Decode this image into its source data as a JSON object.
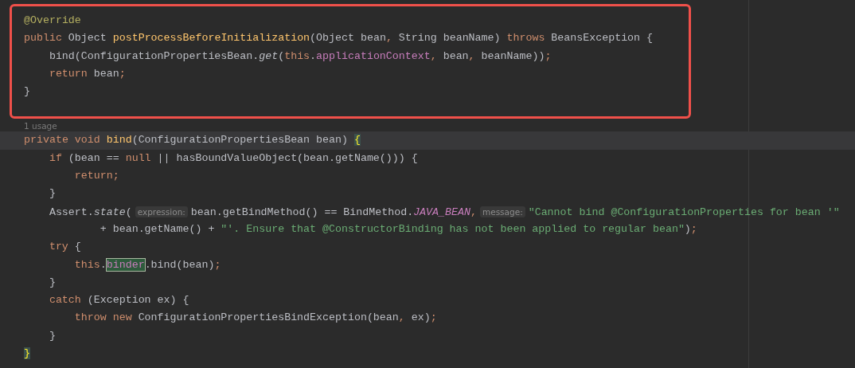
{
  "highlighted_block": {
    "lines": [
      {
        "tokens": [
          {
            "kind": "annotation",
            "text": "@Override"
          }
        ]
      },
      {
        "tokens": [
          {
            "kind": "keyword",
            "text": "public"
          },
          {
            "kind": "plain",
            "text": " Object "
          },
          {
            "kind": "decl",
            "text": "postProcessBeforeInitialization"
          },
          {
            "kind": "plain",
            "text": "(Object bean"
          },
          {
            "kind": "keyword",
            "text": ","
          },
          {
            "kind": "plain",
            "text": " String beanName) "
          },
          {
            "kind": "keyword",
            "text": "throws"
          },
          {
            "kind": "plain",
            "text": " BeansException {"
          }
        ],
        "children": [
          {
            "tokens": [
              {
                "kind": "plain",
                "text": "bind(ConfigurationPropertiesBean."
              },
              {
                "kind": "italic",
                "text": "get"
              },
              {
                "kind": "plain",
                "text": "("
              },
              {
                "kind": "keyword",
                "text": "this"
              },
              {
                "kind": "plain",
                "text": "."
              },
              {
                "kind": "field",
                "text": "applicationContext"
              },
              {
                "kind": "keyword",
                "text": ","
              },
              {
                "kind": "plain",
                "text": " bean"
              },
              {
                "kind": "keyword",
                "text": ","
              },
              {
                "kind": "plain",
                "text": " beanName))"
              },
              {
                "kind": "keyword",
                "text": ";"
              }
            ]
          },
          {
            "tokens": [
              {
                "kind": "keyword",
                "text": "return"
              },
              {
                "kind": "plain",
                "text": " bean"
              },
              {
                "kind": "keyword",
                "text": ";"
              }
            ]
          }
        ]
      },
      {
        "tokens": [
          {
            "kind": "plain",
            "text": "}"
          }
        ]
      }
    ]
  },
  "usage_hint": "1 usage",
  "lines": [
    {
      "current": true,
      "tokens": [
        {
          "kind": "keyword",
          "text": "private void "
        },
        {
          "kind": "decl",
          "text": "bind"
        },
        {
          "kind": "plain",
          "text": "(ConfigurationPropertiesBean bean) "
        },
        {
          "kind": "brace-match",
          "text": "{"
        }
      ],
      "children": [
        {
          "current": false,
          "tokens": [
            {
              "kind": "keyword",
              "text": "if"
            },
            {
              "kind": "plain",
              "text": " (bean == "
            },
            {
              "kind": "keyword",
              "text": "null"
            },
            {
              "kind": "plain",
              "text": " || hasBoundValueObject(bean.getName())) {"
            }
          ],
          "children": [
            {
              "current": false,
              "tokens": [
                {
                  "kind": "keyword",
                  "text": "return;"
                }
              ]
            }
          ]
        },
        {
          "current": false,
          "tokens": [
            {
              "kind": "plain",
              "text": "}"
            }
          ]
        },
        {
          "current": false,
          "tokens": [
            {
              "kind": "plain",
              "text": "Assert."
            },
            {
              "kind": "italic",
              "text": "state"
            },
            {
              "kind": "plain",
              "text": "("
            },
            {
              "kind": "hint",
              "text": "expression:"
            },
            {
              "kind": "plain",
              "text": "bean.getBindMethod() == BindMethod."
            },
            {
              "kind": "field-italic",
              "text": "JAVA_BEAN"
            },
            {
              "kind": "keyword",
              "text": ","
            },
            {
              "kind": "hint",
              "text": "message:"
            },
            {
              "kind": "string",
              "text": "\"Cannot bind @ConfigurationProperties for bean '\""
            }
          ],
          "children": [
            {
              "current": false,
              "continuation": true,
              "tokens": [
                {
                  "kind": "plain",
                  "text": "+ bean.getName() + "
                },
                {
                  "kind": "string",
                  "text": "\"'. Ensure that @ConstructorBinding has not been applied to regular bean\""
                },
                {
                  "kind": "plain",
                  "text": ")"
                },
                {
                  "kind": "keyword",
                  "text": ";"
                }
              ]
            }
          ]
        },
        {
          "current": false,
          "tokens": [
            {
              "kind": "keyword",
              "text": "try"
            },
            {
              "kind": "plain",
              "text": " {"
            }
          ],
          "children": [
            {
              "current": false,
              "tokens": [
                {
                  "kind": "keyword",
                  "text": "this"
                },
                {
                  "kind": "plain",
                  "text": "."
                },
                {
                  "kind": "usage-highlight",
                  "text": "binder"
                },
                {
                  "kind": "plain",
                  "text": ".bind(bean)"
                },
                {
                  "kind": "keyword",
                  "text": ";"
                }
              ]
            }
          ]
        },
        {
          "current": false,
          "tokens": [
            {
              "kind": "plain",
              "text": "}"
            }
          ]
        },
        {
          "current": false,
          "tokens": [
            {
              "kind": "keyword",
              "text": "catch"
            },
            {
              "kind": "plain",
              "text": " (Exception ex) {"
            }
          ],
          "children": [
            {
              "current": false,
              "tokens": [
                {
                  "kind": "keyword",
                  "text": "throw new "
                },
                {
                  "kind": "plain",
                  "text": "ConfigurationPropertiesBindException(bean"
                },
                {
                  "kind": "keyword",
                  "text": ","
                },
                {
                  "kind": "plain",
                  "text": " ex)"
                },
                {
                  "kind": "keyword",
                  "text": ";"
                }
              ]
            }
          ]
        },
        {
          "current": false,
          "tokens": [
            {
              "kind": "plain",
              "text": "}"
            }
          ]
        }
      ]
    },
    {
      "current": false,
      "tokens": [
        {
          "kind": "brace-match",
          "text": "}"
        }
      ]
    }
  ]
}
